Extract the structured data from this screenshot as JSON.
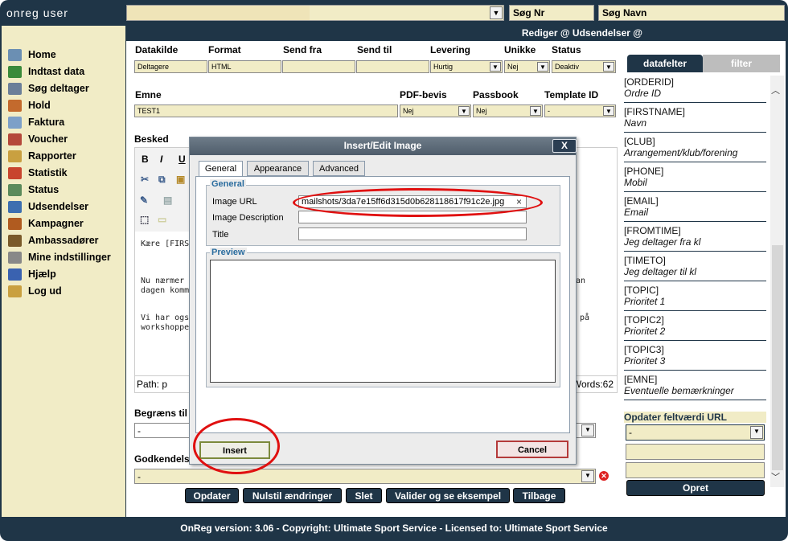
{
  "app": {
    "title": "onreg user"
  },
  "top": {
    "search_nr": "Søg Nr",
    "search_navn": "Søg Navn"
  },
  "sidebar": {
    "items": [
      {
        "label": "Home",
        "icon": "home-icon",
        "color": "#6b8fb3"
      },
      {
        "label": "Indtast data",
        "icon": "add-data-icon",
        "color": "#3a8a3a"
      },
      {
        "label": "Søg deltager",
        "icon": "search-person-icon",
        "color": "#6b7f99"
      },
      {
        "label": "Hold",
        "icon": "team-icon",
        "color": "#c36a2d"
      },
      {
        "label": "Faktura",
        "icon": "invoice-icon",
        "color": "#7da0c8"
      },
      {
        "label": "Voucher",
        "icon": "gift-icon",
        "color": "#b4483a"
      },
      {
        "label": "Rapporter",
        "icon": "reports-icon",
        "color": "#c9a040"
      },
      {
        "label": "Statistik",
        "icon": "chart-icon",
        "color": "#c8452e"
      },
      {
        "label": "Status",
        "icon": "status-icon",
        "color": "#5b8a5b"
      },
      {
        "label": "Udsendelser",
        "icon": "mailing-icon",
        "color": "#3d6fb0"
      },
      {
        "label": "Kampagner",
        "icon": "campaign-icon",
        "color": "#b05b20"
      },
      {
        "label": "Ambassadører",
        "icon": "ambassador-icon",
        "color": "#7a5a2a"
      },
      {
        "label": "Mine indstillinger",
        "icon": "settings-icon",
        "color": "#888888"
      },
      {
        "label": "Hjælp",
        "icon": "help-icon",
        "color": "#3a62b0"
      },
      {
        "label": "Log ud",
        "icon": "logout-icon",
        "color": "#c9a040"
      }
    ]
  },
  "header": {
    "title": "Rediger @ Udsendelser @"
  },
  "form": {
    "labels": {
      "datakilde": "Datakilde",
      "format": "Format",
      "send_fra": "Send fra",
      "send_til": "Send til",
      "levering": "Levering",
      "unikke": "Unikke",
      "status": "Status",
      "emne": "Emne",
      "pdf": "PDF-bevis",
      "passbook": "Passbook",
      "template": "Template ID",
      "besked": "Besked",
      "begraens": "Begræns til",
      "godkendels": "Godkendels"
    },
    "values": {
      "datakilde": "Deltagere",
      "format": "HTML",
      "send_fra": "",
      "send_til": "",
      "levering": "Hurtig",
      "unikke": "Nej",
      "status": "Deaktiv",
      "emne": "TEST1",
      "pdf": "Nej",
      "passbook": "Nej",
      "template": "-",
      "begraens": "-",
      "godkendels": "-"
    }
  },
  "editor": {
    "body": [
      "Kære [FIRS",
      "Nu nærmer",
      "dagen komm",
      "Vi har også",
      "workshoppe"
    ],
    "right_fragments": [
      "an",
      "på"
    ],
    "path": "Path: p",
    "words": "Words:62"
  },
  "buttons": {
    "opdater": "Opdater",
    "nulstil": "Nulstil ændringer",
    "slet": "Slet",
    "valider": "Valider og se eksempel",
    "tilbage": "Tilbage",
    "opret": "Opret"
  },
  "right": {
    "tab_datafelter": "datafelter",
    "tab_filter": "filter",
    "fields": [
      {
        "code": "[ORDERID]",
        "desc": "Ordre ID"
      },
      {
        "code": "[FIRSTNAME]",
        "desc": "Navn"
      },
      {
        "code": "[CLUB]",
        "desc": "Arrangement/klub/forening"
      },
      {
        "code": "[PHONE]",
        "desc": "Mobil"
      },
      {
        "code": "[EMAIL]",
        "desc": "Email"
      },
      {
        "code": "[FROMTIME]",
        "desc": "Jeg deltager fra kl"
      },
      {
        "code": "[TIMETO]",
        "desc": "Jeg deltager til kl"
      },
      {
        "code": "[TOPIC]",
        "desc": "Prioritet 1"
      },
      {
        "code": "[TOPIC2]",
        "desc": "Prioritet 2"
      },
      {
        "code": "[TOPIC3]",
        "desc": "Prioritet 3"
      },
      {
        "code": "[EMNE]",
        "desc": "Eventuelle bemærkninger"
      }
    ],
    "update_label": "Opdater feltværdi URL",
    "update_select": "-"
  },
  "dialog": {
    "title": "Insert/Edit Image",
    "close": "X",
    "tabs": [
      "General",
      "Appearance",
      "Advanced"
    ],
    "general_legend": "General",
    "preview_legend": "Preview",
    "labels": {
      "url": "Image URL",
      "desc": "Image Description",
      "title": "Title"
    },
    "values": {
      "url": "mailshots/3da7e15ff6d315d0b628118617f91c2e.jpg",
      "desc": "",
      "title": ""
    },
    "clear": "×",
    "insert": "Insert",
    "cancel": "Cancel"
  },
  "footer": {
    "text": "OnReg version: 3.06 - Copyright: Ultimate Sport Service - Licensed to: Ultimate Sport Service"
  }
}
